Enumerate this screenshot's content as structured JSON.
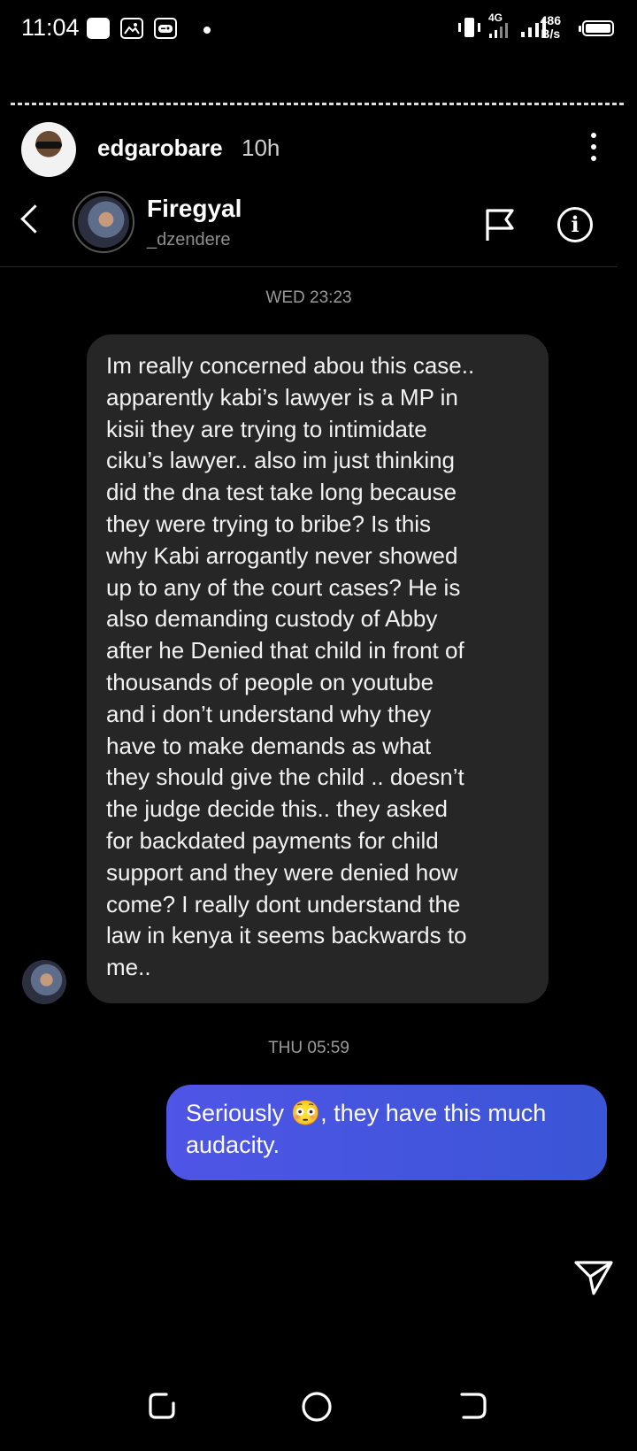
{
  "status_bar": {
    "time": "11:04",
    "network_type": "4G",
    "speed_value": "486",
    "speed_unit": "B/s"
  },
  "story": {
    "username": "edgarobare",
    "age": "10h"
  },
  "chat": {
    "name": "Firegyal",
    "handle": "_dzendere",
    "messages": [
      {
        "timestamp": "WED 23:23",
        "direction": "incoming",
        "text": "Im really concerned abou this case..\napparently kabi’s lawyer is a MP in\nkisii they are trying to intimidate\nciku’s lawyer.. also im just thinking\ndid the dna test take long because\nthey were trying to bribe? Is this\nwhy Kabi arrogantly never showed\nup to any of the court cases? He is\nalso demanding custody of Abby\nafter he Denied that child in front  of\nthousands of people on youtube\nand i don’t understand why they\nhave to make demands as what\nthey should give the child .. doesn’t\nthe judge decide this.. they asked\nfor backdated payments for child\nsupport and they were denied how\ncome? I really dont understand the\nlaw in kenya it seems backwards to\nme.."
      },
      {
        "timestamp": "THU 05:59",
        "direction": "outgoing",
        "text": "Seriously 😳, they have this much\naudacity."
      }
    ]
  },
  "colors": {
    "incoming_bubble": "#262626",
    "outgoing_bubble": "#4152E0",
    "background": "#000000"
  },
  "icons": {
    "back": "chevron-left-icon",
    "report": "flag-icon",
    "info": "info-icon",
    "send": "send-icon",
    "more": "more-vertical-icon"
  }
}
